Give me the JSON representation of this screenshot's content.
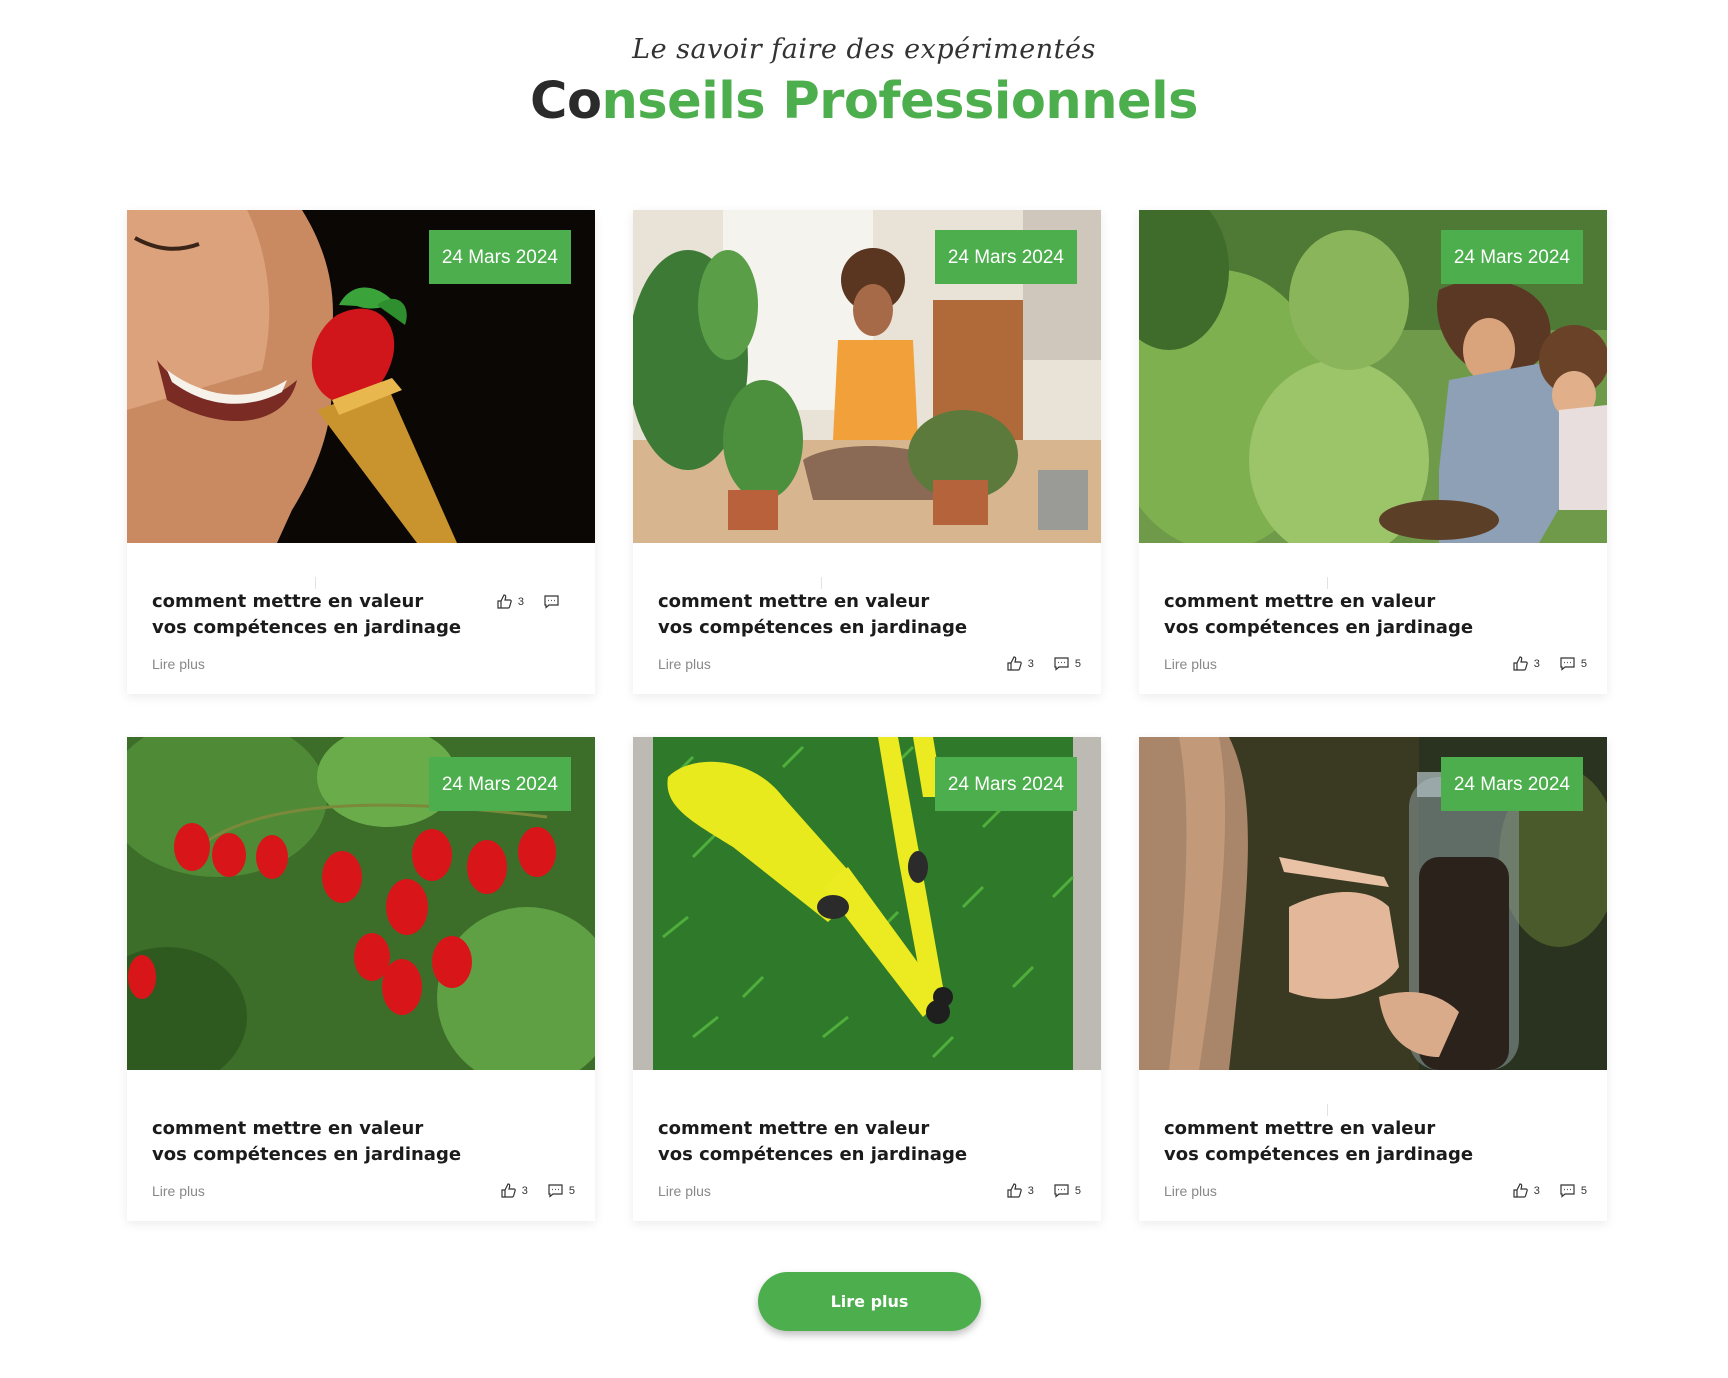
{
  "header": {
    "tagline": "Le savoir faire des expérimentés",
    "title_dark": "Co",
    "title_green": "nseils Professionnels"
  },
  "colors": {
    "accent": "#4cae4c"
  },
  "cards": [
    {
      "date": "24 Mars 2024",
      "title": "comment mettre en valeur vos compétences en jardinage",
      "read_more": "Lire plus",
      "likes": "3",
      "comments": "",
      "image": "woman-eating-strawberry-photo"
    },
    {
      "date": "24 Mars 2024",
      "title": "comment mettre en valeur vos compétences en jardinage",
      "read_more": "Lire plus",
      "likes": "3",
      "comments": "5",
      "image": "woman-with-houseplants-photo"
    },
    {
      "date": "24 Mars 2024",
      "title": "comment mettre en valeur vos compétences en jardinage",
      "read_more": "Lire plus",
      "likes": "3",
      "comments": "5",
      "image": "mother-child-gardening-photo"
    },
    {
      "date": "24 Mars 2024",
      "title": "comment mettre en valeur vos compétences en jardinage",
      "read_more": "Lire plus",
      "likes": "3",
      "comments": "5",
      "image": "strawberry-plant-photo"
    },
    {
      "date": "24 Mars 2024",
      "title": "comment mettre en valeur vos compétences en jardinage",
      "read_more": "Lire plus",
      "likes": "3",
      "comments": "5",
      "image": "yellow-garden-tools-photo"
    },
    {
      "date": "24 Mars 2024",
      "title": "comment mettre en valeur vos compétences en jardinage",
      "read_more": "Lire plus",
      "likes": "3",
      "comments": "5",
      "image": "child-bottle-soil-photo"
    }
  ],
  "button": {
    "label": "Lire plus"
  }
}
